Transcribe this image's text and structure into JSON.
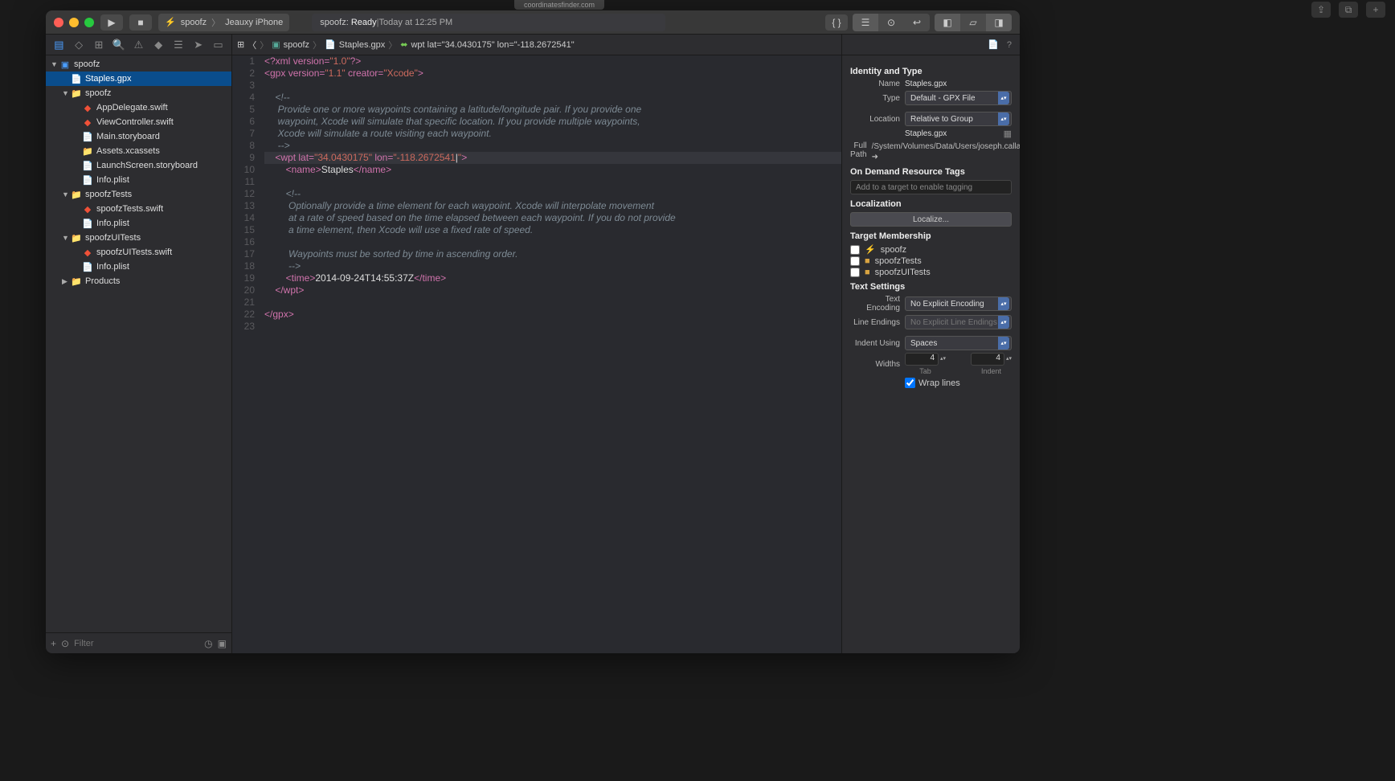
{
  "browser_tab": "coordinatesfinder.com",
  "titlebar": {
    "scheme_name": "spoofz",
    "scheme_dest": "Jeauxy iPhone",
    "status_app": "spoofz:",
    "status_state": "Ready",
    "status_sep": " | ",
    "status_time": "Today at 12:25 PM"
  },
  "sidebar": {
    "filter_placeholder": "Filter",
    "tree": [
      {
        "depth": 0,
        "disc": "▼",
        "icon": "folder-icon",
        "glyph": "▣",
        "label": "spoofz"
      },
      {
        "depth": 1,
        "disc": "",
        "icon": "file-icon",
        "glyph": "📄",
        "label": "Staples.gpx",
        "selected": true
      },
      {
        "depth": 1,
        "disc": "▼",
        "icon": "yellow-folder",
        "glyph": "📁",
        "label": "spoofz"
      },
      {
        "depth": 2,
        "disc": "",
        "icon": "swift-icon",
        "glyph": "◆",
        "label": "AppDelegate.swift"
      },
      {
        "depth": 2,
        "disc": "",
        "icon": "swift-icon",
        "glyph": "◆",
        "label": "ViewController.swift"
      },
      {
        "depth": 2,
        "disc": "",
        "icon": "file-icon",
        "glyph": "📄",
        "label": "Main.storyboard"
      },
      {
        "depth": 2,
        "disc": "",
        "icon": "folder-icon",
        "glyph": "📁",
        "label": "Assets.xcassets"
      },
      {
        "depth": 2,
        "disc": "",
        "icon": "file-icon",
        "glyph": "📄",
        "label": "LaunchScreen.storyboard"
      },
      {
        "depth": 2,
        "disc": "",
        "icon": "file-icon",
        "glyph": "📄",
        "label": "Info.plist"
      },
      {
        "depth": 1,
        "disc": "▼",
        "icon": "yellow-folder",
        "glyph": "📁",
        "label": "spoofzTests"
      },
      {
        "depth": 2,
        "disc": "",
        "icon": "swift-icon",
        "glyph": "◆",
        "label": "spoofzTests.swift"
      },
      {
        "depth": 2,
        "disc": "",
        "icon": "file-icon",
        "glyph": "📄",
        "label": "Info.plist"
      },
      {
        "depth": 1,
        "disc": "▼",
        "icon": "yellow-folder",
        "glyph": "📁",
        "label": "spoofzUITests"
      },
      {
        "depth": 2,
        "disc": "",
        "icon": "swift-icon",
        "glyph": "◆",
        "label": "spoofzUITests.swift"
      },
      {
        "depth": 2,
        "disc": "",
        "icon": "file-icon",
        "glyph": "📄",
        "label": "Info.plist"
      },
      {
        "depth": 1,
        "disc": "▶",
        "icon": "yellow-folder",
        "glyph": "📁",
        "label": "Products"
      }
    ]
  },
  "jumpbar": {
    "seg1": "spoofz",
    "seg2": "Staples.gpx",
    "seg3": "wpt lat=\"34.0430175\" lon=\"-118.2672541\""
  },
  "code_lines": [
    {
      "n": 1,
      "html": "<span class='tag'>&lt;?xml</span> <span class='attr'>version=</span><span class='str'>\"1.0\"</span><span class='tag'>?&gt;</span>"
    },
    {
      "n": 2,
      "html": "<span class='tag'>&lt;gpx</span> <span class='attr'>version=</span><span class='str'>\"1.1\"</span> <span class='attr'>creator=</span><span class='str'>\"Xcode\"</span><span class='tag'>&gt;</span>"
    },
    {
      "n": 3,
      "html": ""
    },
    {
      "n": 4,
      "html": "    <span class='cmt'>&lt;!--</span>"
    },
    {
      "n": 5,
      "html": "     <span class='cmt'>Provide one or more waypoints containing a latitude/longitude pair. If you provide one</span>"
    },
    {
      "n": 6,
      "html": "     <span class='cmt'>waypoint, Xcode will simulate that specific location. If you provide multiple waypoints,</span>"
    },
    {
      "n": 7,
      "html": "     <span class='cmt'>Xcode will simulate a route visiting each waypoint.</span>"
    },
    {
      "n": 8,
      "html": "     <span class='cmt'>--&gt;</span>"
    },
    {
      "n": 9,
      "hl": true,
      "html": "    <span class='tag'>&lt;wpt</span> <span class='attr'>lat=</span><span class='str'>\"34.0430175\"</span> <span class='attr'>lon=</span><span class='str'>\"-118.2672541</span><span class='txt'>|</span><span class='str'>\"</span><span class='tag'>&gt;</span>"
    },
    {
      "n": 10,
      "html": "        <span class='tag'>&lt;name&gt;</span><span class='txt'>Staples</span><span class='tag'>&lt;/name&gt;</span>"
    },
    {
      "n": 11,
      "html": ""
    },
    {
      "n": 12,
      "html": "        <span class='cmt'>&lt;!--</span>"
    },
    {
      "n": 13,
      "html": "         <span class='cmt'>Optionally provide a time element for each waypoint. Xcode will interpolate movement</span>"
    },
    {
      "n": 14,
      "html": "         <span class='cmt'>at a rate of speed based on the time elapsed between each waypoint. If you do not provide</span>"
    },
    {
      "n": 15,
      "html": "         <span class='cmt'>a time element, then Xcode will use a fixed rate of speed.</span>"
    },
    {
      "n": 16,
      "html": ""
    },
    {
      "n": 17,
      "html": "         <span class='cmt'>Waypoints must be sorted by time in ascending order.</span>"
    },
    {
      "n": 18,
      "html": "         <span class='cmt'>--&gt;</span>"
    },
    {
      "n": 19,
      "html": "        <span class='tag'>&lt;time&gt;</span><span class='txt'>2014-09-24T14:55:37Z</span><span class='tag'>&lt;/time&gt;</span>"
    },
    {
      "n": 20,
      "html": "    <span class='tag'>&lt;/wpt&gt;</span>"
    },
    {
      "n": 21,
      "html": ""
    },
    {
      "n": 22,
      "html": "<span class='tag'>&lt;/gpx&gt;</span>"
    },
    {
      "n": 23,
      "html": ""
    }
  ],
  "inspector": {
    "section_identity": "Identity and Type",
    "name_label": "Name",
    "name_value": "Staples.gpx",
    "type_label": "Type",
    "type_value": "Default - GPX File",
    "loc_label": "Location",
    "loc_value": "Relative to Group",
    "loc_file": "Staples.gpx",
    "fullpath_label": "Full Path",
    "fullpath_value": "/System/Volumes/Data/Users/joseph.callaway/Desktop/spoofz/Staples.gpx",
    "section_ondemand": "On Demand Resource Tags",
    "ondemand_placeholder": "Add to a target to enable tagging",
    "section_local": "Localization",
    "localize_btn": "Localize...",
    "section_target": "Target Membership",
    "targets": [
      {
        "name": "spoofz",
        "glyph": "⚡"
      },
      {
        "name": "spoofzTests",
        "glyph": "■"
      },
      {
        "name": "spoofzUITests",
        "glyph": "■"
      }
    ],
    "section_text": "Text Settings",
    "enc_label": "Text Encoding",
    "enc_value": "No Explicit Encoding",
    "le_label": "Line Endings",
    "le_value": "No Explicit Line Endings",
    "indent_label": "Indent Using",
    "indent_value": "Spaces",
    "widths_label": "Widths",
    "tab_val": "4",
    "tab_sublabel": "Tab",
    "indent_val": "4",
    "indent_sublabel": "Indent",
    "wrap_label": "Wrap lines"
  }
}
